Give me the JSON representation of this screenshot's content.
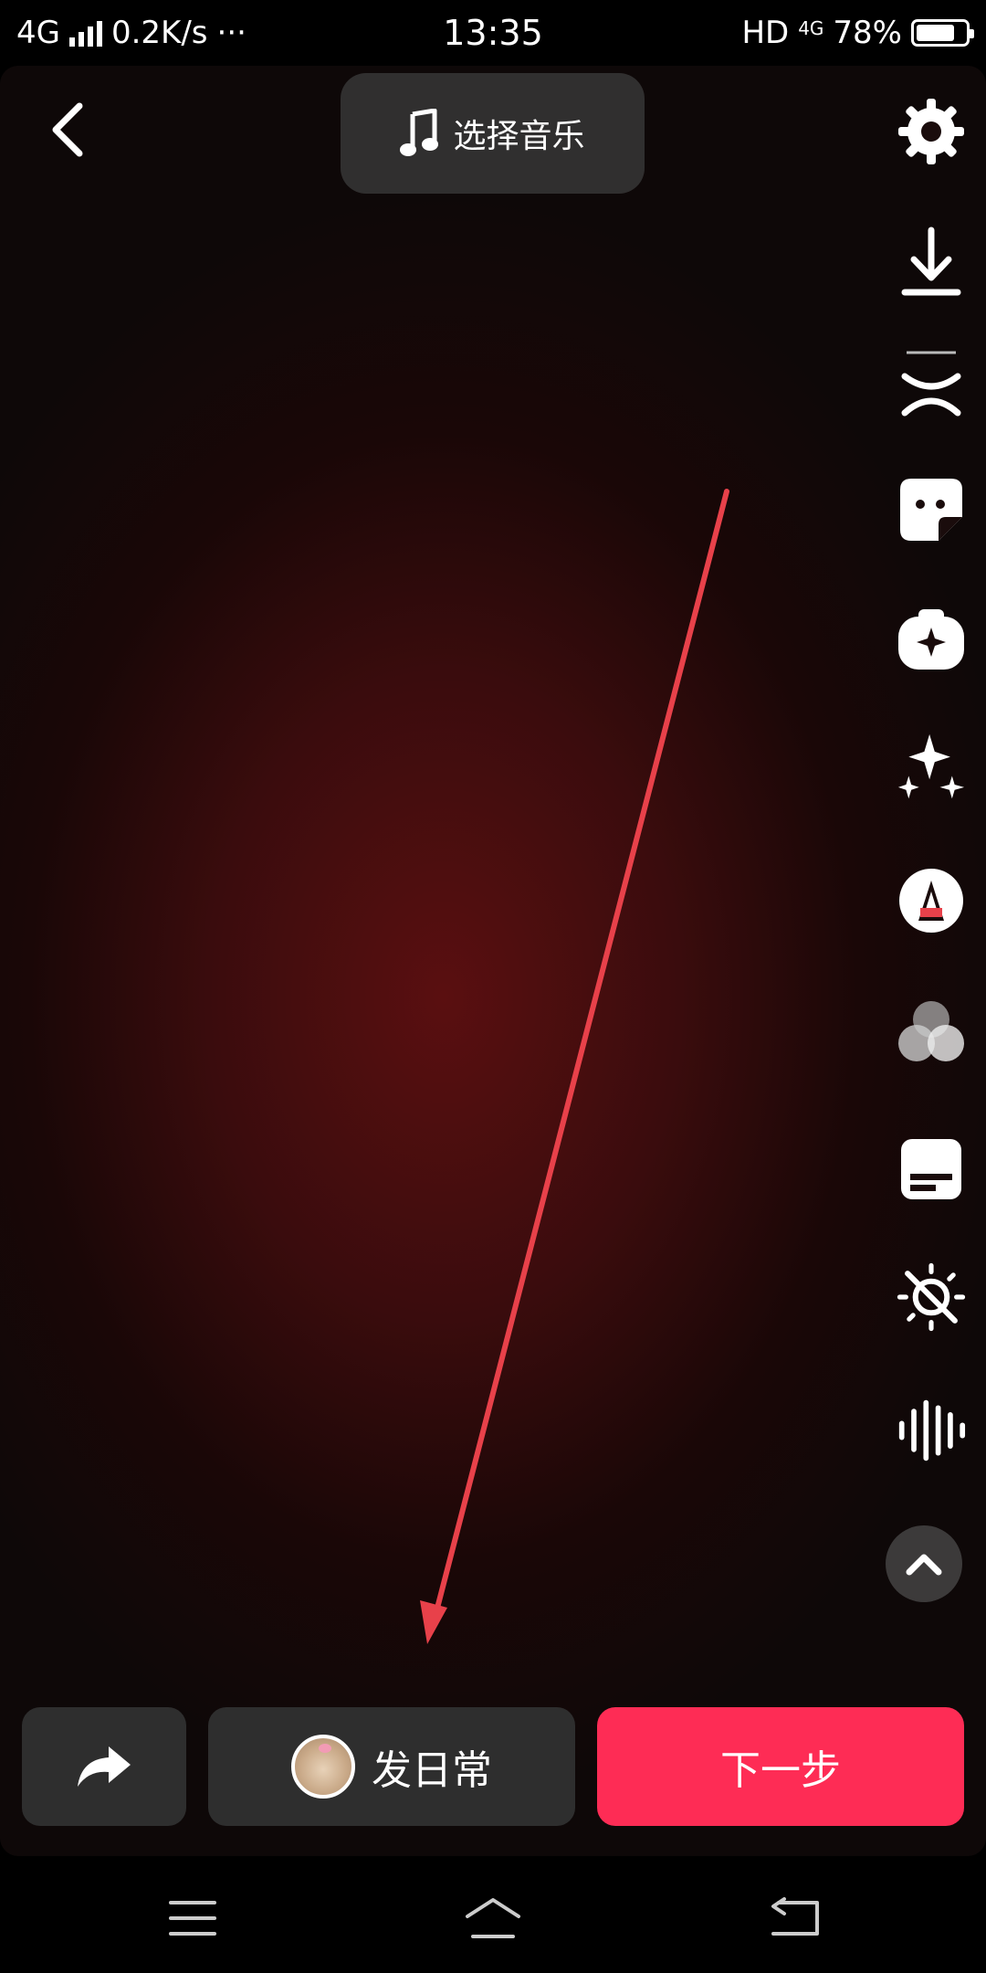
{
  "status_bar": {
    "network": "4G",
    "speed": "0.2K/s",
    "more": "···",
    "time": "13:35",
    "hd": "HD",
    "net_small": "4G",
    "battery_pct": "78%",
    "battery_level": 0.78
  },
  "header": {
    "back_icon": "chevron-left",
    "music_icon": "music-note",
    "music_label": "选择音乐"
  },
  "side_tools": [
    {
      "name": "settings",
      "icon": "gear-icon"
    },
    {
      "name": "download",
      "icon": "download-icon"
    },
    {
      "name": "cut",
      "icon": "scissors-icon"
    },
    {
      "name": "sticker",
      "icon": "sticker-icon"
    },
    {
      "name": "effects",
      "icon": "effects-icon"
    },
    {
      "name": "enhance",
      "icon": "sparkles-icon"
    },
    {
      "name": "text",
      "icon": "text-icon"
    },
    {
      "name": "filters",
      "icon": "filter-circles-icon"
    },
    {
      "name": "captions",
      "icon": "captions-icon"
    },
    {
      "name": "beauty-off",
      "icon": "beauty-off-icon"
    },
    {
      "name": "voice",
      "icon": "waveform-icon"
    },
    {
      "name": "collapse",
      "icon": "chevron-up-icon"
    }
  ],
  "bottom": {
    "share_icon": "share-arrow",
    "daily_label": "发日常",
    "next_label": "下一步"
  },
  "colors": {
    "accent": "#fe2c55",
    "annotation_arrow": "#e8414a"
  },
  "nav_bar": {
    "menu_icon": "menu-lines",
    "home_icon": "home",
    "back_icon": "back-return"
  }
}
